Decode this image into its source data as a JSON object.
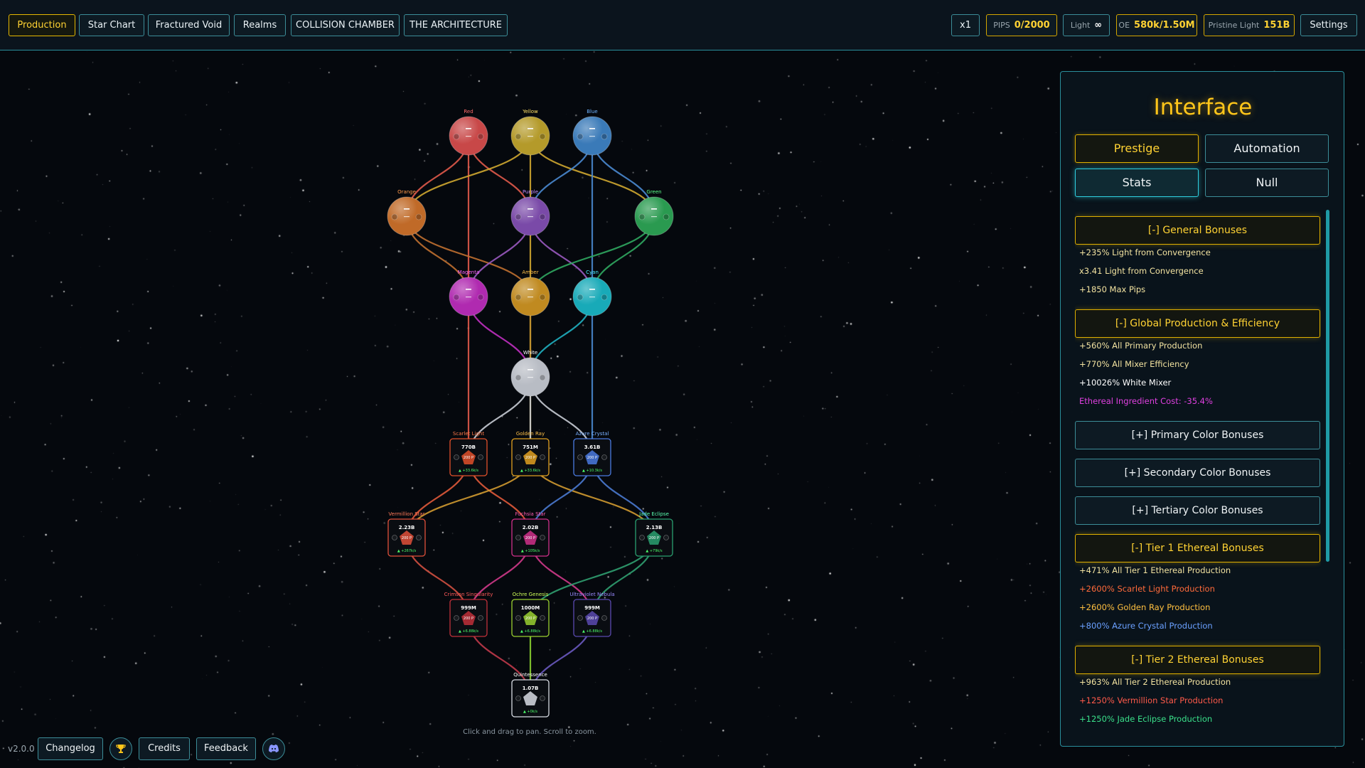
{
  "nav": {
    "tabs": [
      {
        "label": "Production",
        "active": true
      },
      {
        "label": "Star Chart"
      },
      {
        "label": "Fractured Void"
      },
      {
        "label": "Realms"
      },
      {
        "label": "COLLISION CHAMBER"
      },
      {
        "label": "THE ARCHITECTURE"
      }
    ]
  },
  "resources": {
    "speed": "x1",
    "pips_label": "PIPS",
    "pips_value": "0/2000",
    "light_label": "Light",
    "light_value": "∞",
    "oe_label": "OE",
    "oe_value": "580k/1.50M",
    "pristine_label": "Pristine Light",
    "pristine_value": "151B",
    "settings_label": "Settings"
  },
  "tree": {
    "hint": "Click and drag to pan. Scroll to zoom.",
    "nodes": [
      {
        "id": "red",
        "label": "Red",
        "shape": "orb",
        "color": "#c84848",
        "labelColor": "#ff6b6b"
      },
      {
        "id": "yellow",
        "label": "Yellow",
        "shape": "orb",
        "color": "#b49a2a",
        "labelColor": "#ffe066"
      },
      {
        "id": "blue",
        "label": "Blue",
        "shape": "orb",
        "color": "#3a7ab8",
        "labelColor": "#6fb3ff"
      },
      {
        "id": "orange",
        "label": "Orange",
        "shape": "orb",
        "color": "#c06a28",
        "labelColor": "#ff9a4a"
      },
      {
        "id": "purple",
        "label": "Purple",
        "shape": "orb",
        "color": "#7a4aa8",
        "labelColor": "#c38cff"
      },
      {
        "id": "green",
        "label": "Green",
        "shape": "orb",
        "color": "#2a9a50",
        "labelColor": "#5cff8a"
      },
      {
        "id": "magenta",
        "label": "Magenta",
        "shape": "orb",
        "color": "#b02ab0",
        "labelColor": "#ff66ff"
      },
      {
        "id": "amber",
        "label": "Amber",
        "shape": "orb",
        "color": "#c08a20",
        "labelColor": "#ffc04a"
      },
      {
        "id": "cyan",
        "label": "Cyan",
        "shape": "orb",
        "color": "#18aab8",
        "labelColor": "#4af0ff"
      },
      {
        "id": "white",
        "label": "White",
        "shape": "orb",
        "color": "#b8bcc4",
        "labelColor": "#ffffff"
      },
      {
        "id": "scarlet",
        "label": "Scarlet Light",
        "shape": "card",
        "color": "#e0502a",
        "labelColor": "#ff7a4a",
        "value": "770B",
        "cost": "200 P",
        "rate": "▲ +33.6k/s"
      },
      {
        "id": "golden",
        "label": "Golden Ray",
        "shape": "card",
        "color": "#e0a020",
        "labelColor": "#ffc04a",
        "value": "751M",
        "cost": "200 P",
        "rate": "▲ +33.6k/s"
      },
      {
        "id": "azure",
        "label": "Azure Crystal",
        "shape": "card",
        "color": "#4a7ae0",
        "labelColor": "#7ab0ff",
        "value": "3.61B",
        "cost": "200 P",
        "rate": "▲ +10.3k/s"
      },
      {
        "id": "vermillion",
        "label": "Vermillion Star",
        "shape": "card",
        "color": "#e0503a",
        "labelColor": "#ff7a5a",
        "value": "2.23B",
        "cost": "200 P",
        "rate": "▲ +267k/s"
      },
      {
        "id": "fuchsia",
        "label": "Fuchsia Star",
        "shape": "card",
        "color": "#d0308a",
        "labelColor": "#ff5ab0",
        "value": "2.02B",
        "cost": "200 P",
        "rate": "▲ +105k/s"
      },
      {
        "id": "jade",
        "label": "Jade Eclipse",
        "shape": "card",
        "color": "#2aa070",
        "labelColor": "#5affb0",
        "value": "2.13B",
        "cost": "200 P",
        "rate": "▲ +79k/s"
      },
      {
        "id": "crimson",
        "label": "Crimson Singularity",
        "shape": "card",
        "color": "#c0303a",
        "labelColor": "#ff5a5a",
        "value": "999M",
        "cost": "200 P",
        "rate": "▲ +6.88k/s"
      },
      {
        "id": "ochre",
        "label": "Ochre Genesis",
        "shape": "card",
        "color": "#9ad030",
        "labelColor": "#d0ff5a",
        "value": "1000M",
        "cost": "200 P",
        "rate": "▲ +6.88k/s"
      },
      {
        "id": "ultraviolet",
        "label": "Ultraviolet Nebula",
        "shape": "card",
        "color": "#5a4ab0",
        "labelColor": "#9a8aff",
        "value": "999M",
        "cost": "200 P",
        "rate": "▲ +6.88k/s"
      },
      {
        "id": "quint",
        "label": "Quintessence",
        "shape": "card",
        "color": "#d8dce4",
        "labelColor": "#ffffff",
        "value": "1.07B",
        "cost": "",
        "rate": "▲ +0k/s"
      }
    ],
    "links": [
      {
        "from": "red",
        "to": "orange",
        "color": "#e05a4a"
      },
      {
        "from": "red",
        "to": "purple",
        "color": "#e05a4a"
      },
      {
        "from": "red",
        "to": "scarlet",
        "color": "#e05a4a"
      },
      {
        "from": "yellow",
        "to": "orange",
        "color": "#d0a830"
      },
      {
        "from": "yellow",
        "to": "green",
        "color": "#d0a830"
      },
      {
        "from": "yellow",
        "to": "golden",
        "color": "#d0a830"
      },
      {
        "from": "blue",
        "to": "purple",
        "color": "#4a8ad0"
      },
      {
        "from": "blue",
        "to": "green",
        "color": "#4a8ad0"
      },
      {
        "from": "blue",
        "to": "azure",
        "color": "#4a8ad0"
      },
      {
        "from": "orange",
        "to": "magenta",
        "color": "#c07030"
      },
      {
        "from": "orange",
        "to": "amber",
        "color": "#c07030"
      },
      {
        "from": "purple",
        "to": "magenta",
        "color": "#9a5ac0"
      },
      {
        "from": "purple",
        "to": "cyan",
        "color": "#9a5ac0"
      },
      {
        "from": "green",
        "to": "amber",
        "color": "#30a860"
      },
      {
        "from": "green",
        "to": "cyan",
        "color": "#30a860"
      },
      {
        "from": "magenta",
        "to": "white",
        "color": "#c030c0"
      },
      {
        "from": "amber",
        "to": "white",
        "color": "#c09030"
      },
      {
        "from": "cyan",
        "to": "white",
        "color": "#20b0c0"
      },
      {
        "from": "white",
        "to": "scarlet",
        "color": "#c8ccd4"
      },
      {
        "from": "white",
        "to": "golden",
        "color": "#c8ccd4"
      },
      {
        "from": "white",
        "to": "azure",
        "color": "#c8ccd4"
      },
      {
        "from": "scarlet",
        "to": "vermillion",
        "color": "#e05a3a"
      },
      {
        "from": "scarlet",
        "to": "fuchsia",
        "color": "#e05a3a"
      },
      {
        "from": "golden",
        "to": "vermillion",
        "color": "#d09a30"
      },
      {
        "from": "golden",
        "to": "jade",
        "color": "#d09a30"
      },
      {
        "from": "azure",
        "to": "fuchsia",
        "color": "#4a7ad0"
      },
      {
        "from": "azure",
        "to": "jade",
        "color": "#4a7ad0"
      },
      {
        "from": "vermillion",
        "to": "crimson",
        "color": "#d05040"
      },
      {
        "from": "fuchsia",
        "to": "crimson",
        "color": "#d03a8a"
      },
      {
        "from": "fuchsia",
        "to": "ultraviolet",
        "color": "#d03a8a"
      },
      {
        "from": "jade",
        "to": "ochre",
        "color": "#30a070"
      },
      {
        "from": "jade",
        "to": "ultraviolet",
        "color": "#30a070"
      },
      {
        "from": "crimson",
        "to": "quint",
        "color": "#c03a4a"
      },
      {
        "from": "ochre",
        "to": "quint",
        "color": "#8ad030"
      },
      {
        "from": "ultraviolet",
        "to": "quint",
        "color": "#6a5ac0"
      }
    ]
  },
  "panel": {
    "title": "Interface",
    "tabs": [
      {
        "label": "Prestige"
      },
      {
        "label": "Automation"
      },
      {
        "label": "Stats"
      },
      {
        "label": "Null"
      }
    ],
    "sections": [
      {
        "header": "[-] General Bonuses",
        "open": true,
        "items": [
          {
            "text": "+235% Light from Convergence",
            "color": "#f3e3a0"
          },
          {
            "text": "x3.41 Light from Convergence",
            "color": "#f3e3a0"
          },
          {
            "text": "+1850 Max Pips",
            "color": "#f3e3a0"
          }
        ]
      },
      {
        "header": "[-] Global Production & Efficiency",
        "open": true,
        "items": [
          {
            "text": "+560% All Primary Production",
            "color": "#f3e3a0"
          },
          {
            "text": "+770% All Mixer Efficiency",
            "color": "#f3e3a0"
          },
          {
            "text": "+10026% White Mixer",
            "color": "#ffffff"
          },
          {
            "text": "Ethereal Ingredient Cost: -35.4%",
            "color": "#e040e0"
          }
        ]
      },
      {
        "header": "[+] Primary Color Bonuses",
        "open": false,
        "items": []
      },
      {
        "header": "[+] Secondary Color Bonuses",
        "open": false,
        "items": []
      },
      {
        "header": "[+] Tertiary Color Bonuses",
        "open": false,
        "items": []
      },
      {
        "header": "[-] Tier 1 Ethereal Bonuses",
        "open": true,
        "items": [
          {
            "text": "+471% All Tier 1 Ethereal Production",
            "color": "#f3e3a0"
          },
          {
            "text": "+2600% Scarlet Light Production",
            "color": "#ff6a3a"
          },
          {
            "text": "+2600% Golden Ray Production",
            "color": "#ffc040"
          },
          {
            "text": "+800% Azure Crystal Production",
            "color": "#6aa0ff"
          }
        ]
      },
      {
        "header": "[-] Tier 2 Ethereal Bonuses",
        "open": true,
        "items": [
          {
            "text": "+963% All Tier 2 Ethereal Production",
            "color": "#f3e3a0"
          },
          {
            "text": "+1250% Vermillion Star Production",
            "color": "#ff5a4a"
          },
          {
            "text": "+1250% Jade Eclipse Production",
            "color": "#3ae08a"
          }
        ]
      }
    ]
  },
  "footer": {
    "version": "v2.0.0",
    "changelog_label": "Changelog",
    "trophy_icon": "trophy-icon",
    "credits_label": "Credits",
    "feedback_label": "Feedback",
    "discord_icon": "discord-icon"
  }
}
